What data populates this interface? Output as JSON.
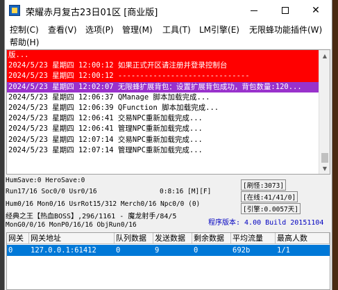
{
  "window": {
    "title": "荣耀赤月复古23日01区 [商业版]"
  },
  "menu": [
    {
      "label": "控制(C)"
    },
    {
      "label": "查看(V)"
    },
    {
      "label": "选项(P)"
    },
    {
      "label": "管理(M)"
    },
    {
      "label": "工具(T)"
    },
    {
      "label": "LM引擎(E)"
    },
    {
      "label": "无限蜂功能插件(W)"
    },
    {
      "label": "帮助(H)"
    }
  ],
  "log": {
    "lines": [
      {
        "text": "版...",
        "style": "red"
      },
      {
        "text": "2024/5/23 星期四 12:00:12 如果正式开区请注册并登录控制台",
        "style": "red"
      },
      {
        "text": "2024/5/23 星期四 12:00:12 ------------------------------",
        "style": "red"
      },
      {
        "text": "2024/5/23 星期四 12:02:07 无限蜂扩展背包：设置扩展背包成功，背包数量:120...",
        "style": "purple"
      },
      {
        "text": "2024/5/23 星期四 12:06:37 QManage 脚本加载完成...",
        "style": "normal"
      },
      {
        "text": "2024/5/23 星期四 12:06:39 QFunction 脚本加载完成...",
        "style": "normal"
      },
      {
        "text": "2024/5/23 星期四 12:06:41 交易NPC重新加载完成...",
        "style": "normal"
      },
      {
        "text": "2024/5/23 星期四 12:06:41 管理NPC重新加载完成...",
        "style": "normal"
      },
      {
        "text": "2024/5/23 星期四 12:07:14 交易NPC重新加载完成...",
        "style": "normal"
      },
      {
        "text": "2024/5/23 星期四 12:07:14 管理NPC重新加载完成...",
        "style": "normal"
      }
    ]
  },
  "status": {
    "humsave": "HumSave:0 HeroSave:0",
    "run": "Run17/16 Soc0/0 Usr0/16",
    "time": "0:8:16 [M][F]",
    "hum": "Hum0/16 Mon0/16 UsrRot15/312 Merch0/16 Npc0/0 (0)",
    "classic": "经典之王【热血BOSS】,296/1161 - 魔龙射手/84/5",
    "mon": "MonG0/0/16 MonP0/16/16 ObjRun0/16",
    "shua_guai": "[刷怪:3073]",
    "online": "[在线:41/41/0]",
    "engine": "[引擎:0.0057天]",
    "version": "程序版本: 4.00 Build 20151104"
  },
  "table": {
    "headers": [
      "网关",
      "网关地址",
      "队列数据",
      "发送数据",
      "剩余数据",
      "平均流量",
      "最高人数"
    ],
    "rows": [
      {
        "cells": [
          "0",
          "127.0.0.1:61412",
          "0",
          "9",
          "0",
          "692b",
          "1/1"
        ]
      }
    ]
  },
  "colors": {
    "log_red": "#ff0000",
    "log_purple": "#9932cc",
    "selection": "#0078d7",
    "version_text": "#0000c0"
  },
  "icons": {
    "app": "app-icon",
    "minimize": "minimize-icon",
    "maximize": "maximize-icon",
    "close": "close-icon"
  }
}
